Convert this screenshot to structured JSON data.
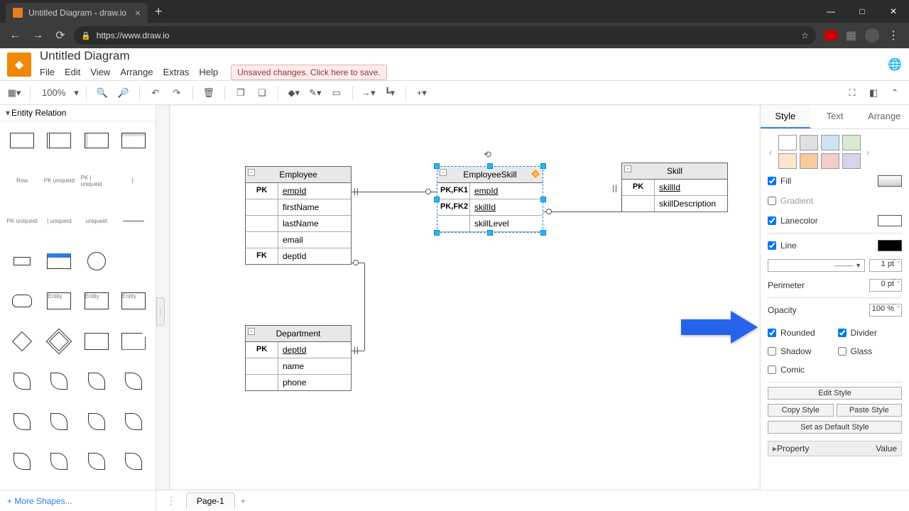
{
  "browser": {
    "tab_title": "Untitled Diagram - draw.io",
    "url": "https://www.draw.io"
  },
  "header": {
    "doc_title": "Untitled Diagram",
    "menu": [
      "File",
      "Edit",
      "View",
      "Arrange",
      "Extras",
      "Help"
    ],
    "save_warning": "Unsaved changes. Click here to save."
  },
  "toolbar": {
    "zoom": "100%"
  },
  "left_panel": {
    "section": "Entity Relation",
    "row_label": "Row",
    "more_shapes": "+ More Shapes..."
  },
  "canvas": {
    "employee": {
      "title": "Employee",
      "rows": [
        {
          "k": "PK",
          "v": "empId",
          "u": true
        },
        {
          "k": "",
          "v": "firstName"
        },
        {
          "k": "",
          "v": "lastName"
        },
        {
          "k": "",
          "v": "email"
        },
        {
          "k": "FK",
          "v": "deptId"
        }
      ]
    },
    "employee_skill": {
      "title": "EmployeeSkill",
      "rows": [
        {
          "k": "PK,FK1",
          "v": "empId",
          "u": true
        },
        {
          "k": "PK,FK2",
          "v": "skillId",
          "u": true
        },
        {
          "k": "",
          "v": "skillLevel"
        }
      ]
    },
    "skill": {
      "title": "Skill",
      "rows": [
        {
          "k": "PK",
          "v": "skillId",
          "u": true
        },
        {
          "k": "",
          "v": "skillDescription"
        }
      ]
    },
    "department": {
      "title": "Department",
      "rows": [
        {
          "k": "PK",
          "v": "deptId",
          "u": true
        },
        {
          "k": "",
          "v": "name"
        },
        {
          "k": "",
          "v": "phone"
        }
      ]
    }
  },
  "right_panel": {
    "tabs": [
      "Style",
      "Text",
      "Arrange"
    ],
    "swatches1": [
      "#ffffff",
      "#e0e0e0",
      "#cfe2f3",
      "#d9ead3"
    ],
    "swatches2": [
      "#fce5cd",
      "#f9cb9c",
      "#f4cccc",
      "#d9d2e9"
    ],
    "fill_label": "Fill",
    "gradient_label": "Gradient",
    "lanecolor_label": "Lanecolor",
    "line_label": "Line",
    "line_pt": "1 pt",
    "perimeter_label": "Perimeter",
    "perimeter_val": "0 pt",
    "opacity_label": "Opacity",
    "opacity_val": "100 %",
    "rounded": "Rounded",
    "divider": "Divider",
    "shadow": "Shadow",
    "glass": "Glass",
    "comic": "Comic",
    "edit_style": "Edit Style",
    "copy_style": "Copy Style",
    "paste_style": "Paste Style",
    "default_style": "Set as Default Style",
    "property": "Property",
    "value": "Value"
  },
  "footer": {
    "page": "Page-1"
  }
}
